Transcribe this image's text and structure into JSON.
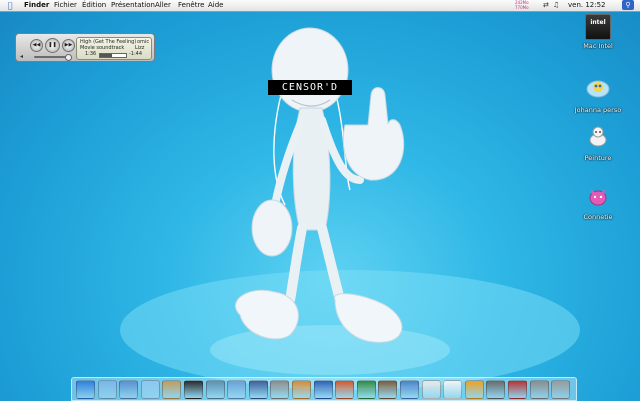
{
  "menubar": {
    "apple_icon": "apple-icon",
    "items": [
      "Finder",
      "Fichier",
      "Édition",
      "Présentation",
      "Aller",
      "Fenêtre",
      "Aide"
    ],
    "memory": [
      "242Mo",
      "770Mo"
    ],
    "clock": "ven. 12:52",
    "right_icons": [
      "volume-icon",
      "sync-icon",
      "spotlight-icon"
    ]
  },
  "player": {
    "track_title": "High (Get The Feeling)",
    "track_extra": "omic",
    "album": "Movie soundtrack",
    "artist_extra": "Lizz",
    "time_elapsed": "1:36",
    "time_remaining": "-1:44",
    "progress": 0.47,
    "volume": 0.9
  },
  "mascot": {
    "censor_text": "CENSOR'D"
  },
  "desktop_icons": [
    {
      "label": "Mac Intel",
      "icon": "intel-drive-icon"
    },
    {
      "label": "Johanna perso",
      "icon": "tweety-folder-icon"
    },
    {
      "label": "Peinture",
      "icon": "dog-folder-icon"
    },
    {
      "label": "Connetie",
      "icon": "pink-cat-folder-icon"
    }
  ],
  "dock": {
    "items": [
      "finder-icon",
      "safari-icon",
      "mail-icon",
      "ichat-icon",
      "address-book-icon",
      "dashboard-icon",
      "iphoto-icon",
      "itunes-icon",
      "imovie-icon",
      "idvd-icon",
      "garageband-icon",
      "word-icon",
      "powerpoint-icon",
      "excel-icon",
      "dictionary-icon",
      "preview-icon",
      "ical-icon",
      "textedit-icon",
      "pages-icon",
      "calculator-icon",
      "photo-booth-icon",
      "system-preferences-icon",
      "trash-icon"
    ]
  }
}
